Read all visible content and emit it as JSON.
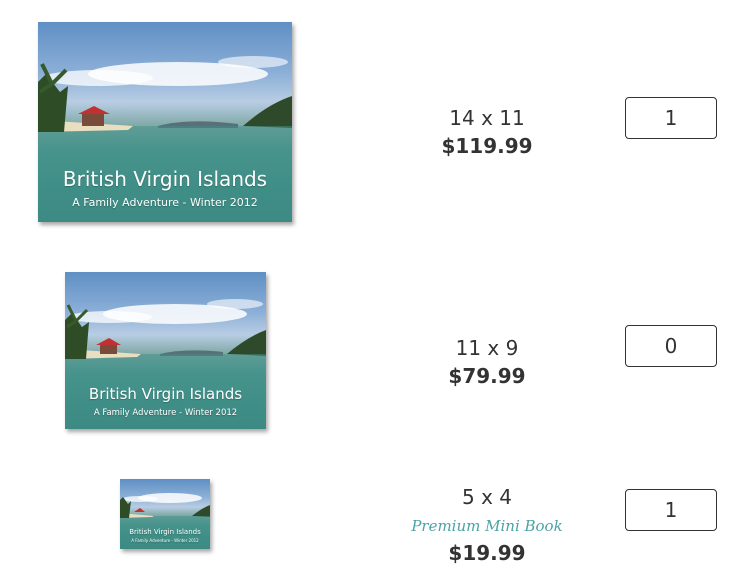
{
  "products": [
    {
      "cover": {
        "title": "British Virgin Islands",
        "subtitle": "A Family Adventure - Winter 2012"
      },
      "size": "14 x 11",
      "price": "$119.99",
      "quantity": "1"
    },
    {
      "cover": {
        "title": "British Virgin Islands",
        "subtitle": "A Family Adventure - Winter 2012"
      },
      "size": "11 x 9",
      "price": "$79.99",
      "quantity": "0"
    },
    {
      "cover": {
        "title": "British Virgin Islands",
        "subtitle": "A Family Adventure - Winter 2012"
      },
      "size": "5 x 4",
      "label": "Premium Mini Book",
      "price": "$19.99",
      "quantity": "1"
    }
  ],
  "colors": {
    "text": "#333333",
    "accent": "#4aa3a6",
    "water": "#3f8d86"
  }
}
